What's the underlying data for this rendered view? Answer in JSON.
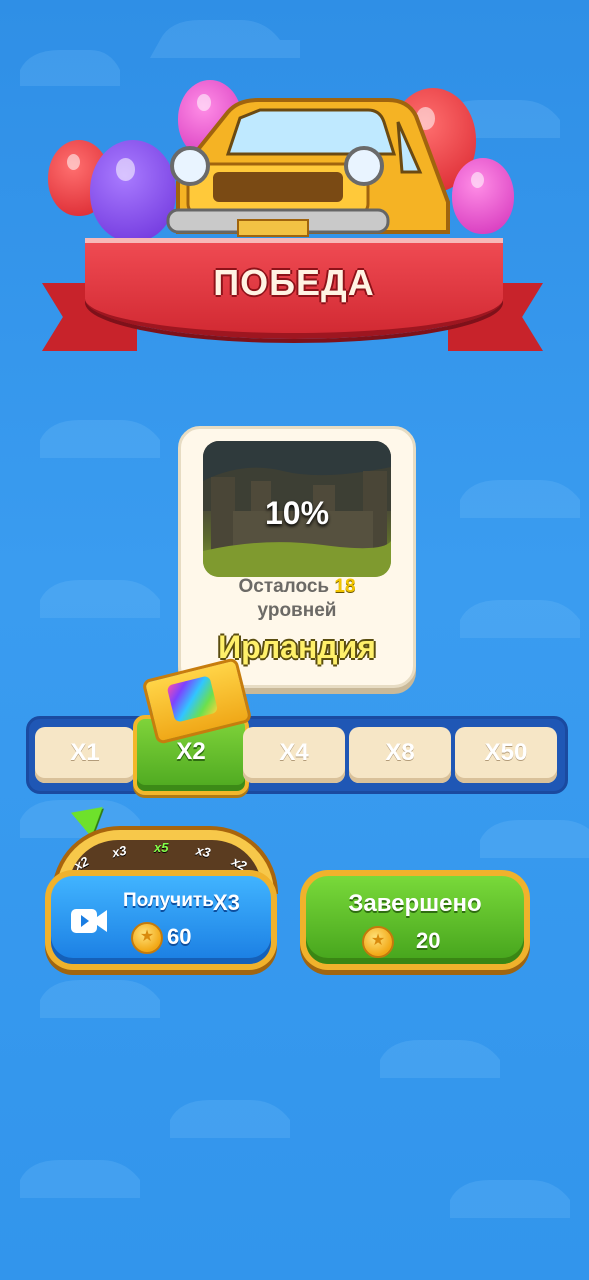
{
  "header": {
    "title": "ПОБЕДА"
  },
  "level_card": {
    "progress": "10%",
    "remaining_prefix": "Осталось",
    "remaining_count": "18",
    "remaining_suffix": "уровней",
    "country": "Ирландия"
  },
  "multipliers": {
    "items": [
      "X1",
      "X2",
      "X4",
      "X8",
      "X50"
    ],
    "selected": "X2"
  },
  "wheel": {
    "segments": [
      "x2",
      "x3",
      "x5",
      "x3",
      "x2"
    ]
  },
  "get_button": {
    "label": "Получить",
    "multiplier": "X3",
    "coins": "60"
  },
  "done_button": {
    "label": "Завершено",
    "coins": "20"
  },
  "colors": {
    "accent_green": "#4da820",
    "accent_blue": "#1a7de2",
    "ribbon_red": "#d22a33",
    "gold": "#f0b22c"
  },
  "icons": [
    "car-icon",
    "balloon-icon",
    "ticket-icon",
    "video-icon",
    "coin-icon",
    "pointer-icon"
  ]
}
